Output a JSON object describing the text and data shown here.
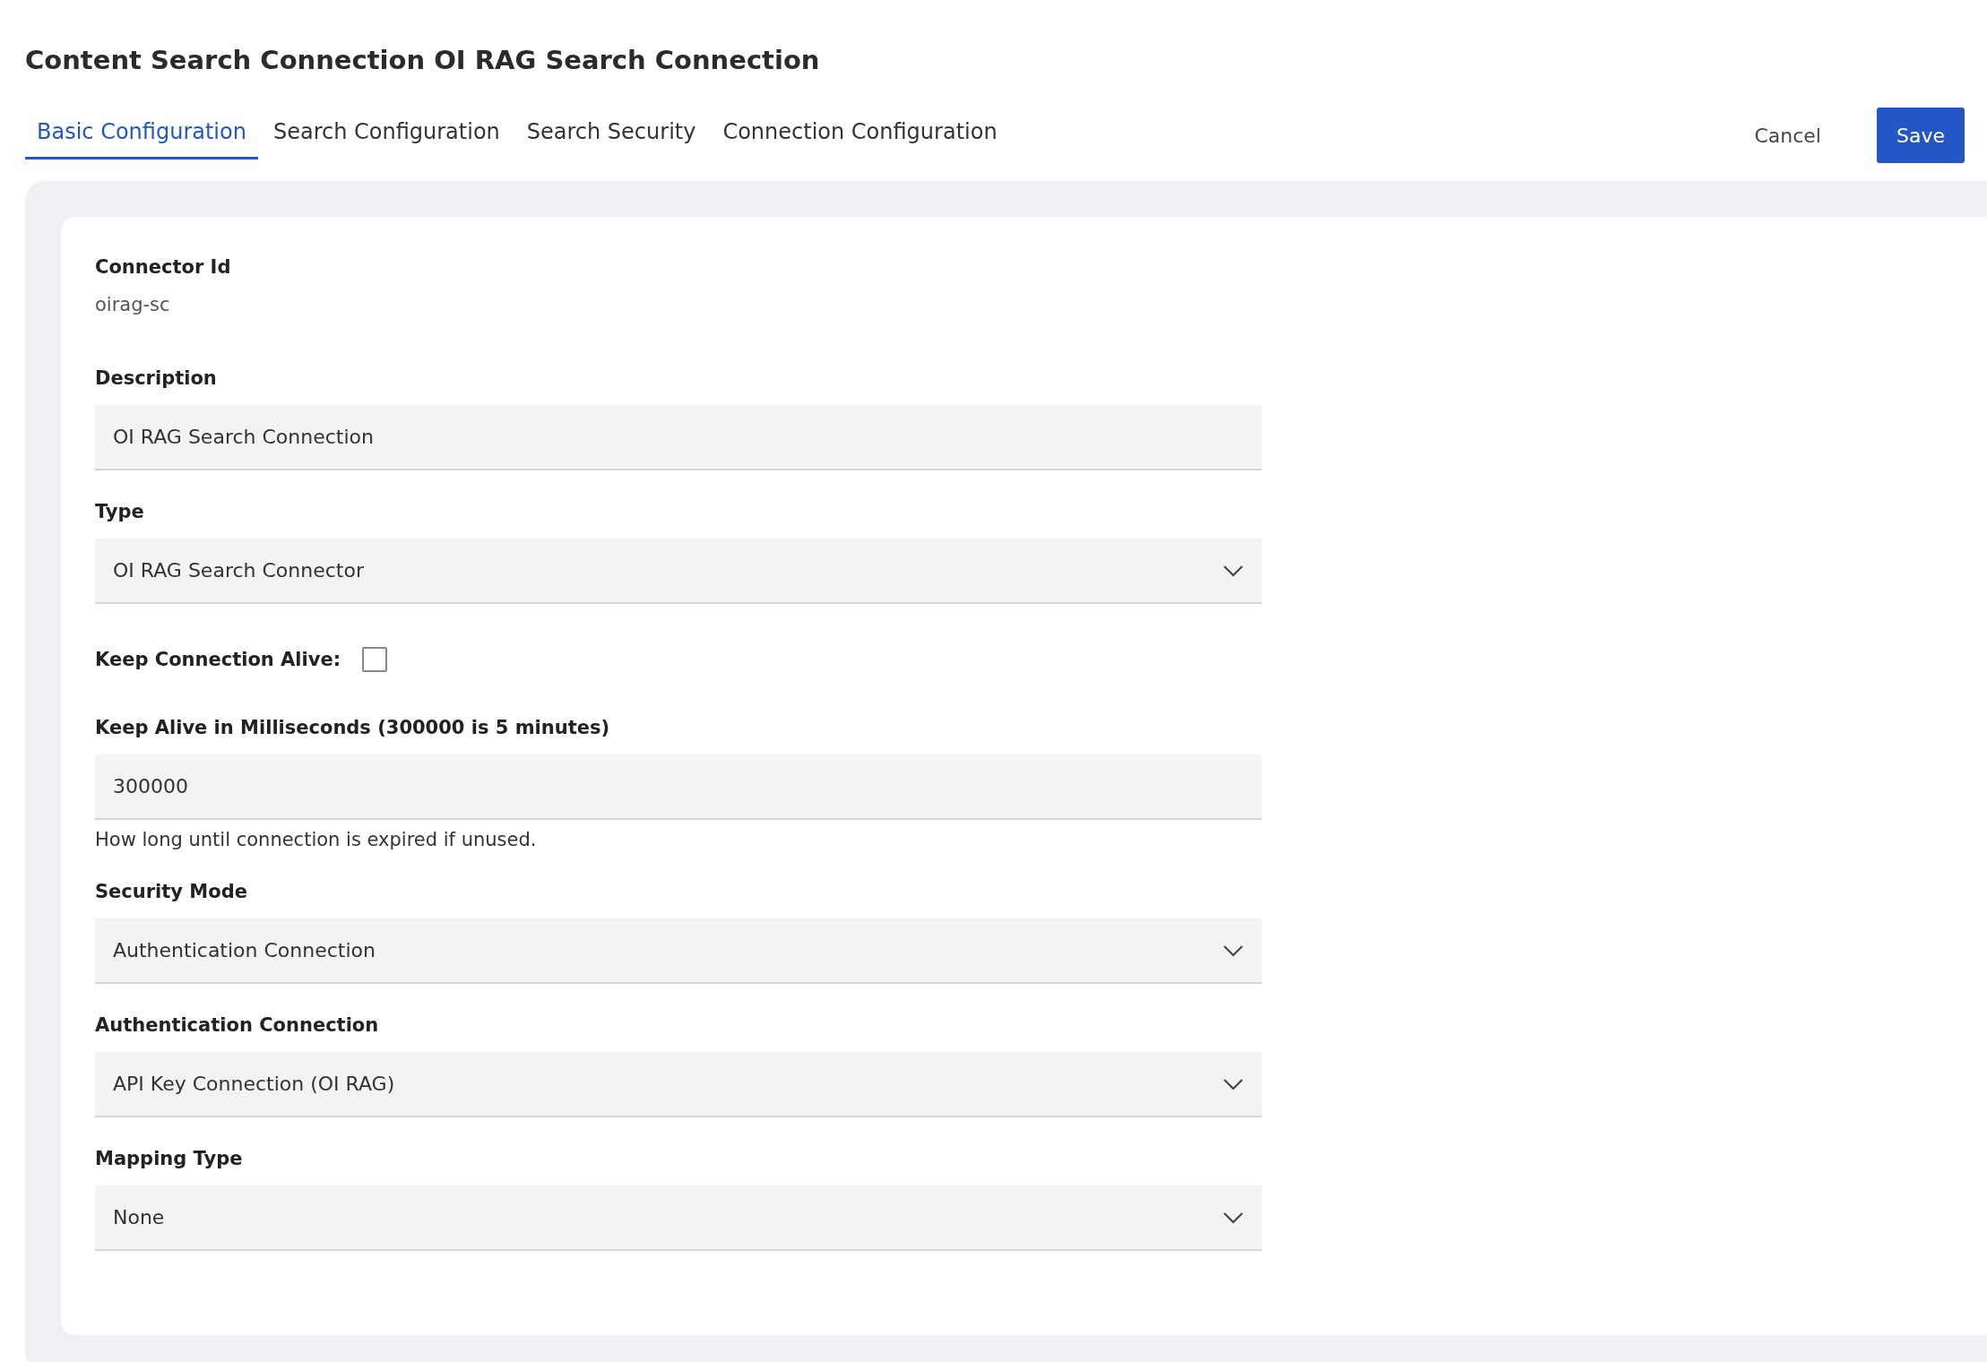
{
  "title": "Content Search Connection OI RAG Search Connection",
  "tabs": [
    {
      "label": "Basic Configuration",
      "selected": true
    },
    {
      "label": "Search Configuration",
      "selected": false
    },
    {
      "label": "Search Security",
      "selected": false
    },
    {
      "label": "Connection Configuration",
      "selected": false
    }
  ],
  "actions": {
    "cancel": "Cancel",
    "save": "Save"
  },
  "fields": [
    {
      "kind": "readonly",
      "label": "Connector Id",
      "value": "oirag-sc"
    },
    {
      "kind": "input",
      "label": "Description",
      "value": "OI RAG Search Connection"
    },
    {
      "kind": "select",
      "label": "Type",
      "value": "OI RAG Search Connector"
    },
    {
      "kind": "checkbox",
      "label": "Keep Connection Alive:",
      "checked": false
    },
    {
      "kind": "input",
      "label": "Keep Alive in Milliseconds (300000 is 5 minutes)",
      "value": "300000",
      "help": "How long until connection is expired if unused."
    },
    {
      "kind": "select",
      "label": "Security Mode",
      "value": "Authentication Connection"
    },
    {
      "kind": "select",
      "label": "Authentication Connection",
      "value": "API Key Connection (OI RAG)"
    },
    {
      "kind": "select",
      "label": "Mapping Type",
      "value": "None"
    }
  ]
}
